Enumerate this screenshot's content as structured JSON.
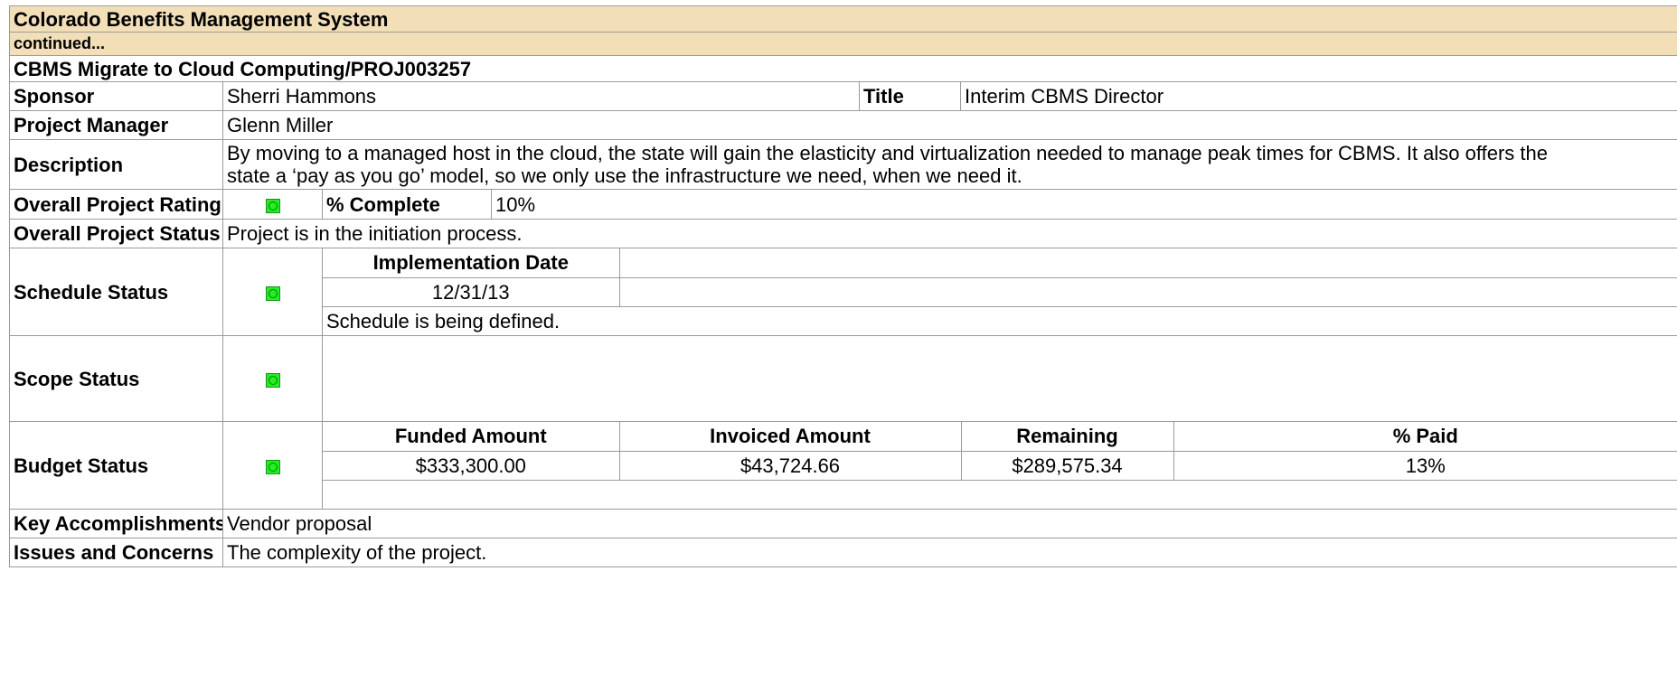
{
  "header": {
    "system_title": "Colorado Benefits Management System",
    "continued": "continued..."
  },
  "project": {
    "title": "CBMS Migrate to Cloud Computing/PROJ003257",
    "sponsor_label": "Sponsor",
    "sponsor": "Sherri Hammons",
    "title_label": "Title",
    "sponsor_title": "Interim CBMS Director",
    "pm_label": "Project Manager",
    "pm": "Glenn Miller",
    "description_label": "Description",
    "description": "By moving to a managed host in the cloud, the state will gain the elasticity and virtualization needed to manage peak times for CBMS.  It also offers the state a ‘pay as you go’ model, so we only use the infrastructure we need, when we need it.",
    "rating_label": "Overall Project Rating",
    "rating_color": "#22ee22",
    "complete_label": "% Complete",
    "complete": "10%",
    "status_label": "Overall Project Status",
    "status": "Project is in the initiation process."
  },
  "schedule": {
    "label": "Schedule Status",
    "indicator_color": "#22ee22",
    "date_header": "Implementation Date",
    "date": "12/31/13",
    "note": "Schedule is being defined."
  },
  "scope": {
    "label": "Scope Status",
    "indicator_color": "#22ee22"
  },
  "budget": {
    "label": "Budget Status",
    "indicator_color": "#22ee22",
    "headers": [
      "Funded Amount",
      "Invoiced Amount",
      "Remaining",
      "% Paid"
    ],
    "values": [
      "$333,300.00",
      "$43,724.66",
      "$289,575.34",
      "13%"
    ]
  },
  "accomplishments": {
    "label": "Key Accomplishments",
    "value": "Vendor proposal"
  },
  "issues": {
    "label": "Issues and Concerns",
    "value": "The complexity of the project."
  }
}
